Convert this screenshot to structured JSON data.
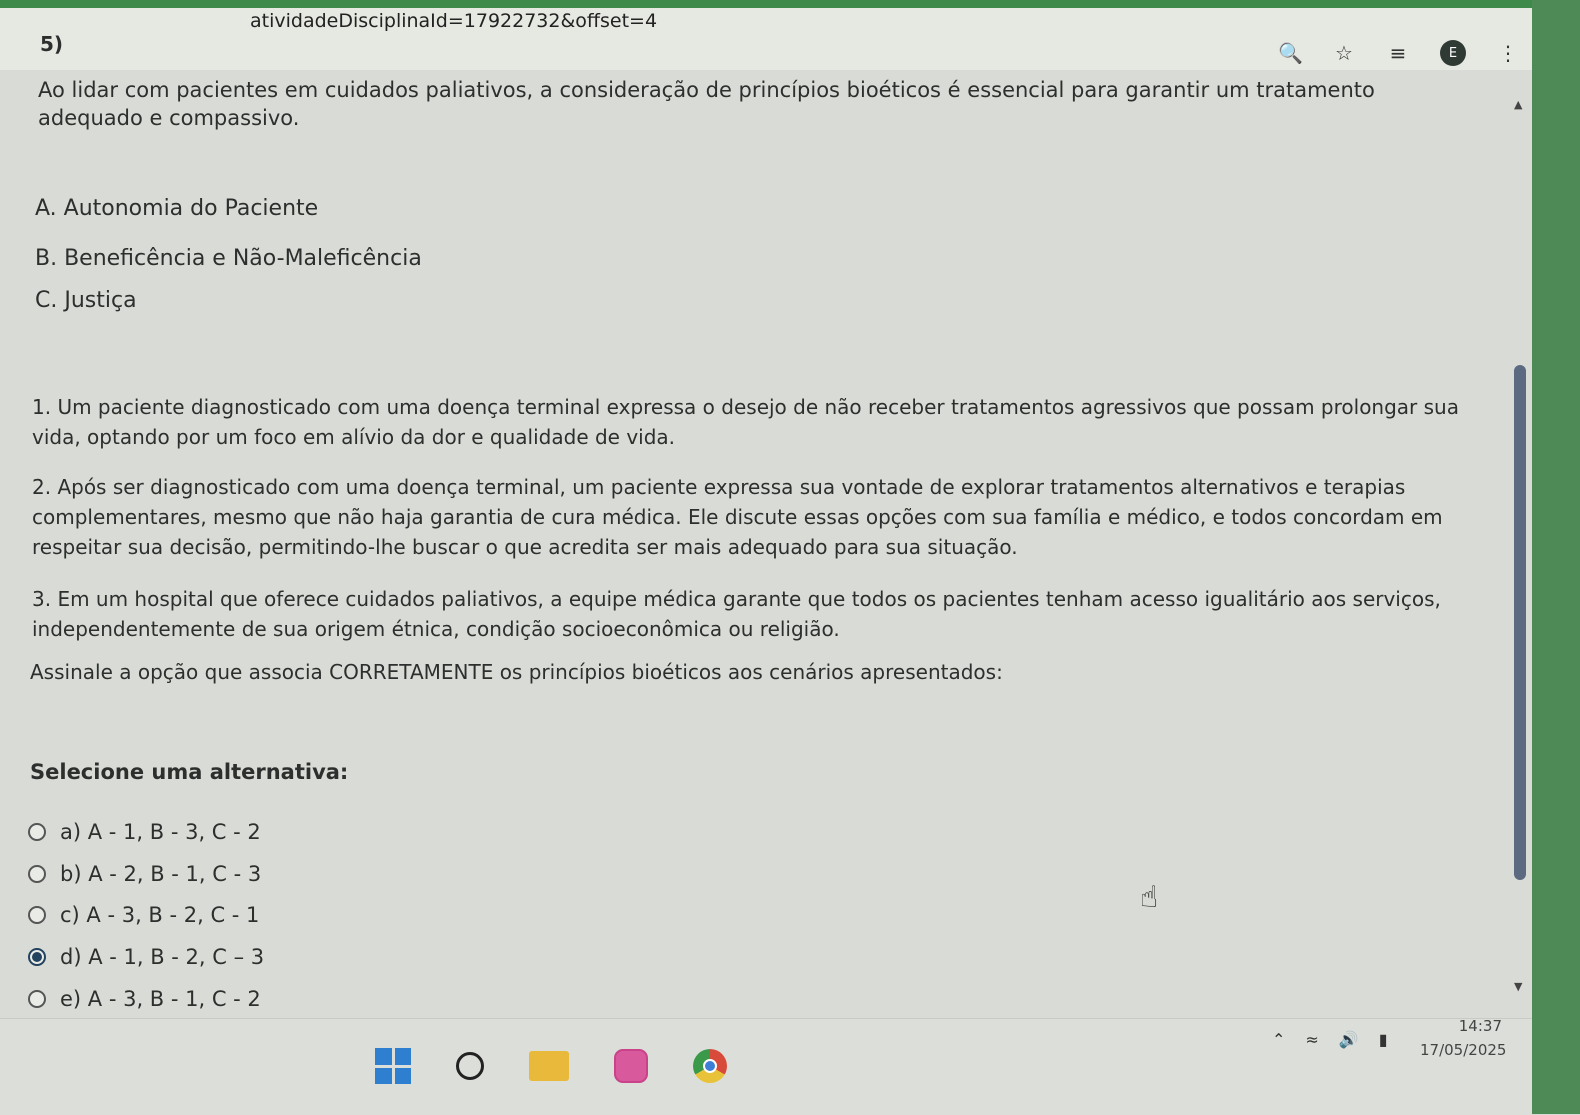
{
  "browser": {
    "url_fragment": "atividadeDisciplinaId=17922732&offset=4",
    "avatar_letter": "E"
  },
  "question": {
    "number": "5)",
    "statement": "Ao lidar com pacientes em cuidados paliativos, a consideração de princípios bioéticos é essencial para garantir um tratamento adequado e compassivo.",
    "principles": [
      "A. Autonomia do Paciente",
      "B. Beneficência e Não-Maleficência",
      "C. Justiça"
    ],
    "scenarios": [
      "1. Um paciente diagnosticado com uma doença terminal expressa o desejo de não receber tratamentos agressivos que possam prolongar sua vida, optando por um foco em alívio da dor e qualidade de vida.",
      "2. Após ser diagnosticado com uma doença terminal, um paciente expressa sua vontade de explorar tratamentos alternativos e terapias complementares, mesmo que não haja garantia de cura médica. Ele discute essas opções com sua família e médico, e todos concordam em respeitar sua decisão, permitindo-lhe buscar o que acredita ser mais adequado para sua situação.",
      "3. Em um hospital que oferece cuidados paliativos, a equipe médica garante que todos os pacientes tenham acesso igualitário aos serviços, independentemente de sua origem étnica, condição socioeconômica ou religião."
    ],
    "ask": "Assinale a opção que associa CORRETAMENTE os princípios bioéticos aos cenários apresentados:",
    "select_title": "Selecione uma alternativa:",
    "alternatives": [
      {
        "label": "a) A - 1, B - 3, C - 2",
        "selected": false
      },
      {
        "label": "b) A - 2, B - 1, C - 3",
        "selected": false
      },
      {
        "label": "c) A - 3, B - 2, C - 1",
        "selected": false
      },
      {
        "label": "d) A - 1, B - 2, C – 3",
        "selected": true
      },
      {
        "label": "e) A - 3, B - 1, C - 2",
        "selected": false
      }
    ]
  },
  "taskbar": {
    "time": "14:37",
    "date": "17/05/2025"
  },
  "colors": {
    "accent_green": "#3d8a4a",
    "radio_selected": "#23425f",
    "scroll_thumb": "#5b6a80"
  }
}
